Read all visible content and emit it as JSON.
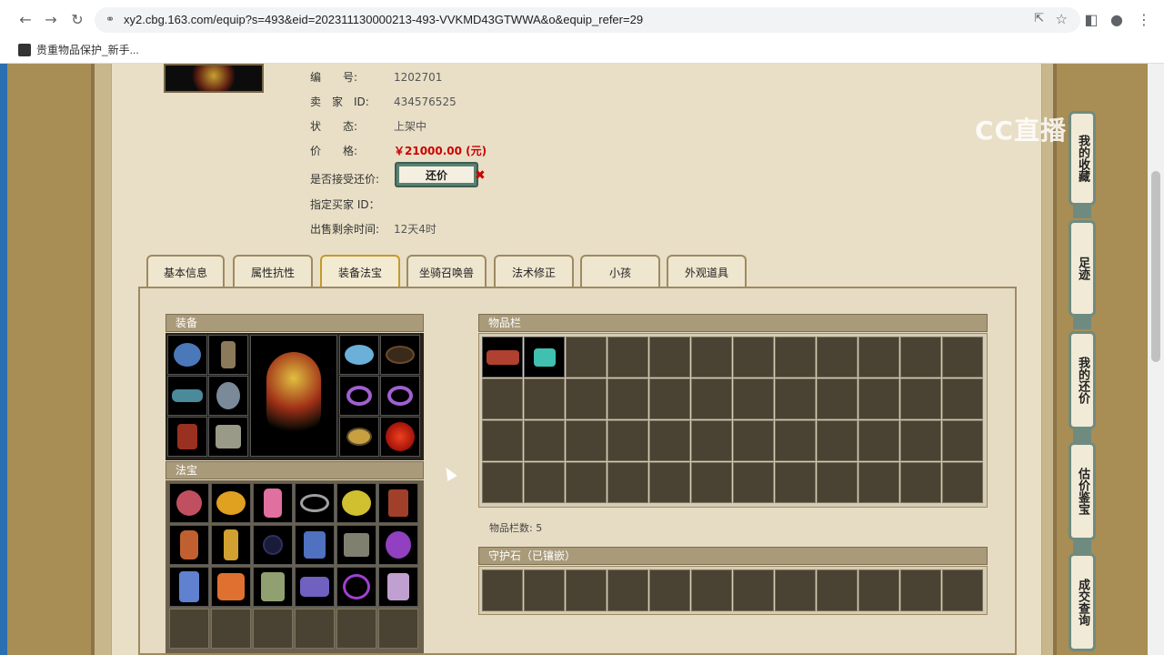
{
  "browser": {
    "url": "xy2.cbg.163.com/equip?s=493&eid=202311130000213-493-VVKMD43GTWWA&o&equip_refer=29",
    "bookmark": "贵重物品保护_新手...",
    "icons": [
      "arrow-left-icon",
      "arrow-right-icon",
      "reload-icon",
      "lock-icon",
      "share-icon",
      "star-icon",
      "sidebar-icon",
      "profile-icon",
      "more-icon"
    ]
  },
  "watermark": "CC直播",
  "item_info": {
    "rows": [
      {
        "label": "编　　号:",
        "value": "1202701"
      },
      {
        "label": "卖　家　ID:",
        "value": "434576525"
      },
      {
        "label": "状　　态:",
        "value": "上架中"
      },
      {
        "label": "价　　格:",
        "value": "￥21000.00 (元)"
      },
      {
        "label": "是否接受还价:",
        "value": ""
      },
      {
        "label": "指定买家 ID：",
        "value": ""
      },
      {
        "label": "出售剩余时间:",
        "value": "12天4时"
      }
    ],
    "counter_offer_button": "还价"
  },
  "tabs": [
    {
      "label": "基本信息",
      "active": false
    },
    {
      "label": "属性抗性",
      "active": false
    },
    {
      "label": "装备法宝",
      "active": true
    },
    {
      "label": "坐骑召唤兽",
      "active": false
    },
    {
      "label": "法术修正",
      "active": false
    },
    {
      "label": "小孩",
      "active": false
    },
    {
      "label": "外观道具",
      "active": false
    }
  ],
  "sections": {
    "equipment_title": "装备",
    "treasure_title": "法宝",
    "inventory_title": "物品栏",
    "inventory_count": "物品栏数: 5",
    "guard_stone_title": "守护石（已镶嵌）"
  },
  "sidebar": [
    {
      "label": "我的收藏"
    },
    {
      "label": "足迹"
    },
    {
      "label": "我的还价"
    },
    {
      "label": "估价鉴宝"
    },
    {
      "label": "成交查询"
    }
  ],
  "colors": {
    "price": "#cc0000",
    "accent_green": "#5a8173",
    "panel_bg": "#e6dcc3",
    "slot_empty": "#4a4233"
  }
}
